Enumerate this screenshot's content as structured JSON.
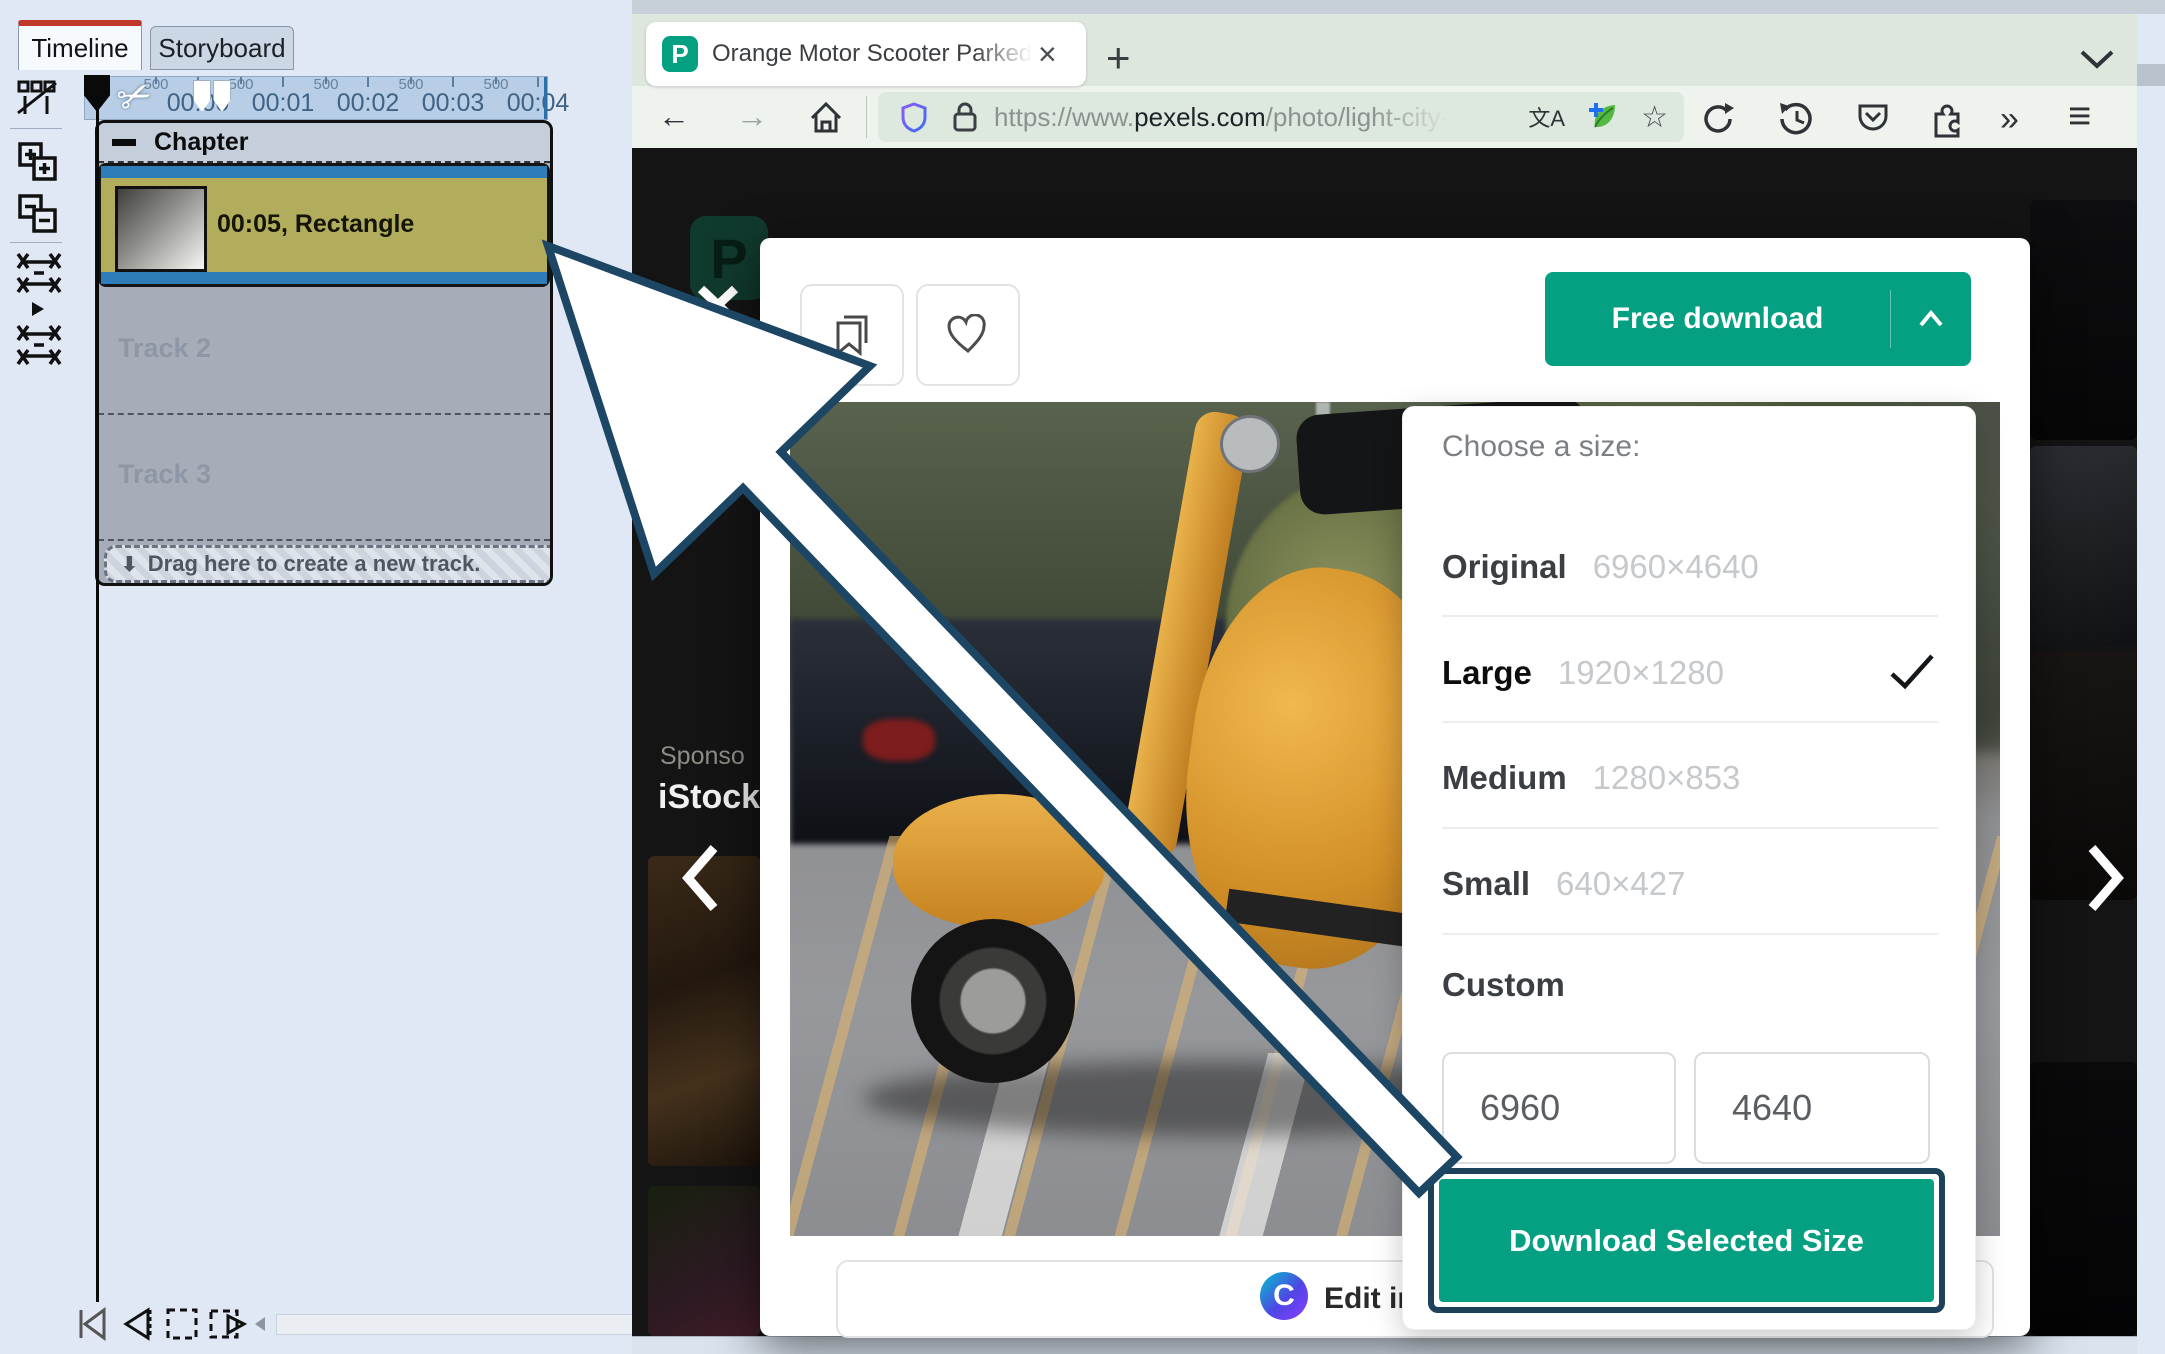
{
  "timeline": {
    "tabs": {
      "timeline": "Timeline",
      "storyboard": "Storyboard"
    },
    "ruler": {
      "labels": [
        "00:00",
        "00:01",
        "00:02",
        "00:03",
        "00:04"
      ],
      "subs": [
        "500",
        "500",
        "500",
        "500",
        "500"
      ]
    },
    "chapter_label": "Chapter",
    "clip_label": "00:05, Rectangle",
    "tracks": {
      "track2": "Track 2",
      "track3": "Track 3"
    },
    "drag_hint": "Drag here to create a new track.",
    "drag_arrow": "⬇",
    "scissors_glyph": "✂",
    "icon_names": [
      "arrange-tracks-icon",
      "zoom-in-icon",
      "zoom-out-icon",
      "fit-timeline-icon",
      "expand-arrow-icon",
      "fit-selection-icon"
    ],
    "transport_icon_names": [
      "skip-to-start-icon",
      "previous-frame-icon",
      "selection-region-icon",
      "slide-view-icon",
      "scroll-left-icon"
    ]
  },
  "browser": {
    "tab": {
      "favicon_letter": "P",
      "title": "Orange Motor Scooter Parked o",
      "close": "×"
    },
    "new_tab": "+",
    "url": {
      "scheme": "https://www.",
      "domain": "pexels.com",
      "path": "/photo/light-city-r"
    },
    "icons": {
      "back": "←",
      "forward": "→",
      "translate": "文A",
      "star": "☆",
      "overflow": "»",
      "menu": "≡"
    }
  },
  "pexels": {
    "logo_letter": "P",
    "close_x": "✕",
    "sponsor": {
      "line1": "Sponso",
      "line2": "iStock"
    },
    "free_download": "Free download",
    "dialog": {
      "heading": "Choose a size:",
      "options": [
        {
          "label": "Original",
          "size": "6960×4640",
          "selected": false
        },
        {
          "label": "Large",
          "size": "1920×1280",
          "selected": true
        },
        {
          "label": "Medium",
          "size": "1280×853",
          "selected": false
        },
        {
          "label": "Small",
          "size": "640×427",
          "selected": false
        }
      ],
      "custom_label": "Custom",
      "custom_width": "6960",
      "custom_height": "4640",
      "download_button": "Download Selected Size"
    },
    "edit_in": "Edit in",
    "canva_letter": "C"
  },
  "colors": {
    "accent_teal": "#05a081",
    "arrow_border": "#1c4663",
    "clip_olive": "#b2ad5c",
    "clip_blue": "#2e7cb8"
  }
}
